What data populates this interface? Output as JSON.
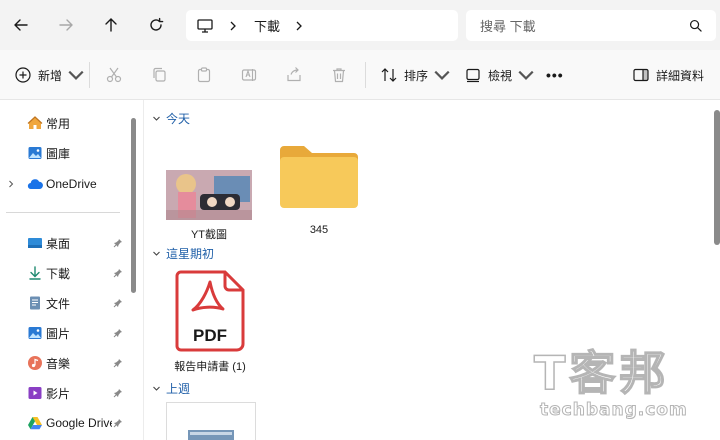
{
  "address_bar": {
    "location_icon": "pc-icon",
    "crumbs": [
      "下載"
    ],
    "search_placeholder": "搜尋 下載"
  },
  "toolbar": {
    "new_label": "新增",
    "sort_label": "排序",
    "view_label": "檢視",
    "more_label": "•••",
    "details_label": "詳細資料"
  },
  "sidebar": {
    "items": [
      {
        "label": "常用",
        "icon": "home-icon"
      },
      {
        "label": "圖庫",
        "icon": "gallery-icon"
      },
      {
        "label": "OneDrive",
        "icon": "onedrive-icon"
      },
      {
        "label": "桌面",
        "icon": "desktop-icon"
      },
      {
        "label": "下載",
        "icon": "download-icon"
      },
      {
        "label": "文件",
        "icon": "documents-icon"
      },
      {
        "label": "圖片",
        "icon": "pictures-icon"
      },
      {
        "label": "音樂",
        "icon": "music-icon"
      },
      {
        "label": "影片",
        "icon": "videos-icon"
      },
      {
        "label": "Google Drive",
        "icon": "google-drive-icon"
      }
    ]
  },
  "groups": [
    {
      "title": "今天",
      "files": [
        {
          "name": "YT截圖",
          "kind": "image-thumbnail"
        },
        {
          "name": "345",
          "kind": "folder"
        }
      ]
    },
    {
      "title": "這星期初",
      "files": [
        {
          "name": "報告申請書 (1)",
          "kind": "pdf",
          "badge": "PDF"
        }
      ]
    },
    {
      "title": "上週",
      "files": [
        {
          "name": "",
          "kind": "document-thumbnail"
        }
      ]
    }
  ],
  "watermark": {
    "big": "T客邦",
    "small": "techbang.com"
  },
  "colors": {
    "accent": "#0067c0",
    "folder": "#f5c24f",
    "pdf": "#d93b3b",
    "group_header": "#1f5fa8"
  }
}
